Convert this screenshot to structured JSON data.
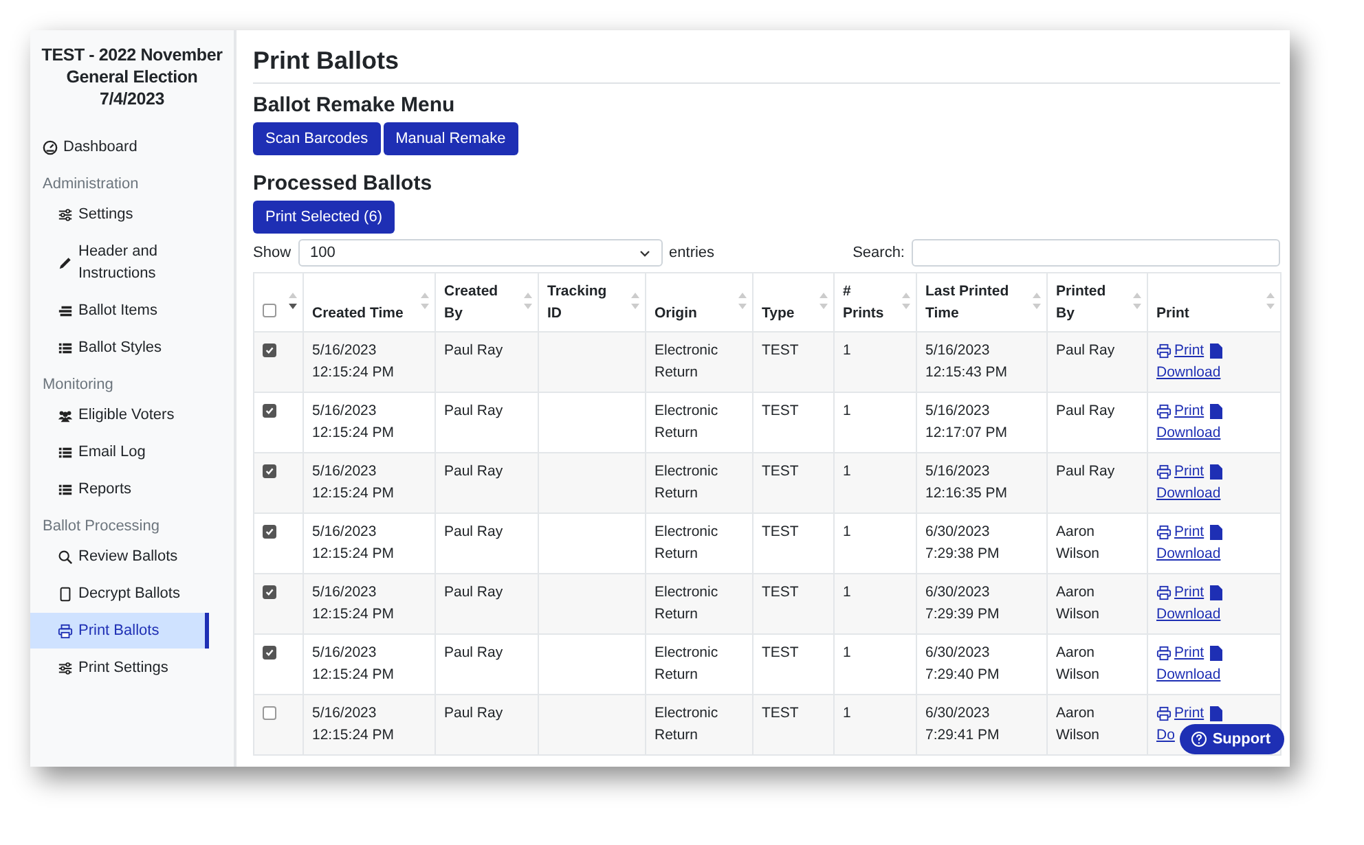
{
  "sidebar": {
    "title": "TEST - 2022 November General Election 7/4/2023",
    "sections": [
      {
        "items": [
          {
            "label": "Dashboard",
            "selected": false
          }
        ]
      },
      {
        "heading": "Administration",
        "items": [
          {
            "label": "Settings",
            "selected": false
          },
          {
            "label": "Header and Instructions",
            "selected": false
          },
          {
            "label": "Ballot Items",
            "selected": false
          },
          {
            "label": "Ballot Styles",
            "selected": false
          }
        ]
      },
      {
        "heading": "Monitoring",
        "items": [
          {
            "label": "Eligible Voters",
            "selected": false
          },
          {
            "label": "Email Log",
            "selected": false
          },
          {
            "label": "Reports",
            "selected": false
          }
        ]
      },
      {
        "heading": "Ballot Processing",
        "items": [
          {
            "label": "Review Ballots",
            "selected": false
          },
          {
            "label": "Decrypt Ballots",
            "selected": false
          },
          {
            "label": "Print Ballots",
            "selected": true
          },
          {
            "label": "Print Settings",
            "selected": false
          }
        ]
      }
    ]
  },
  "page_title": "Print Ballots",
  "remake_heading": "Ballot Remake Menu",
  "remake_buttons": [
    "Scan Barcodes",
    "Manual Remake"
  ],
  "processed_heading": "Processed Ballots",
  "print_selected_button": "Print Selected (6)",
  "show_label": "Show",
  "entries_select": "100",
  "entries_label": "entries",
  "search_label": "Search:",
  "table": {
    "select_all_checked": false,
    "columns": [
      {
        "sorted": true
      },
      {
        "label": "Created Time",
        "sorted": false
      },
      {
        "label": "Created By",
        "sorted": false
      },
      {
        "label": "Tracking ID",
        "sorted": false
      },
      {
        "label": "Origin",
        "sorted": false
      },
      {
        "label": "Type",
        "sorted": false
      },
      {
        "label": "# Prints",
        "sorted": false
      },
      {
        "label": "Last Printed Time",
        "sorted": false
      },
      {
        "label": "Printed By",
        "sorted": false
      },
      {
        "label": "Print",
        "sorted": false
      }
    ],
    "rows": [
      {
        "checked": true,
        "created_time": "5/16/2023 12:15:24 PM",
        "created_by": "Paul Ray",
        "origin": "Electronic Return",
        "type": "TEST",
        "prints": "1",
        "last_printed": "5/16/2023 12:15:43 PM",
        "printed_by": "Paul Ray",
        "print": "Print",
        "download": "Download"
      },
      {
        "checked": true,
        "created_time": "5/16/2023 12:15:24 PM",
        "created_by": "Paul Ray",
        "origin": "Electronic Return",
        "type": "TEST",
        "prints": "1",
        "last_printed": "5/16/2023 12:17:07 PM",
        "printed_by": "Paul Ray",
        "print": "Print",
        "download": "Download"
      },
      {
        "checked": true,
        "created_time": "5/16/2023 12:15:24 PM",
        "created_by": "Paul Ray",
        "origin": "Electronic Return",
        "type": "TEST",
        "prints": "1",
        "last_printed": "5/16/2023 12:16:35 PM",
        "printed_by": "Paul Ray",
        "print": "Print",
        "download": "Download"
      },
      {
        "checked": true,
        "created_time": "5/16/2023 12:15:24 PM",
        "created_by": "Paul Ray",
        "origin": "Electronic Return",
        "type": "TEST",
        "prints": "1",
        "last_printed": "6/30/2023 7:29:38 PM",
        "printed_by": "Aaron Wilson",
        "print": "Print",
        "download": "Download"
      },
      {
        "checked": true,
        "created_time": "5/16/2023 12:15:24 PM",
        "created_by": "Paul Ray",
        "origin": "Electronic Return",
        "type": "TEST",
        "prints": "1",
        "last_printed": "6/30/2023 7:29:39 PM",
        "printed_by": "Aaron Wilson",
        "print": "Print",
        "download": "Download"
      },
      {
        "checked": true,
        "created_time": "5/16/2023 12:15:24 PM",
        "created_by": "Paul Ray",
        "origin": "Electronic Return",
        "type": "TEST",
        "prints": "1",
        "last_printed": "6/30/2023 7:29:40 PM",
        "printed_by": "Aaron Wilson",
        "print": "Print",
        "download": "Download"
      },
      {
        "checked": false,
        "created_time": "5/16/2023 12:15:24 PM",
        "created_by": "Paul Ray",
        "origin": "Electronic Return",
        "type": "TEST",
        "prints": "1",
        "last_printed": "6/30/2023 7:29:41 PM",
        "printed_by": "Aaron Wilson",
        "print": "Print",
        "download": "Do"
      }
    ]
  },
  "support_button": "Support"
}
